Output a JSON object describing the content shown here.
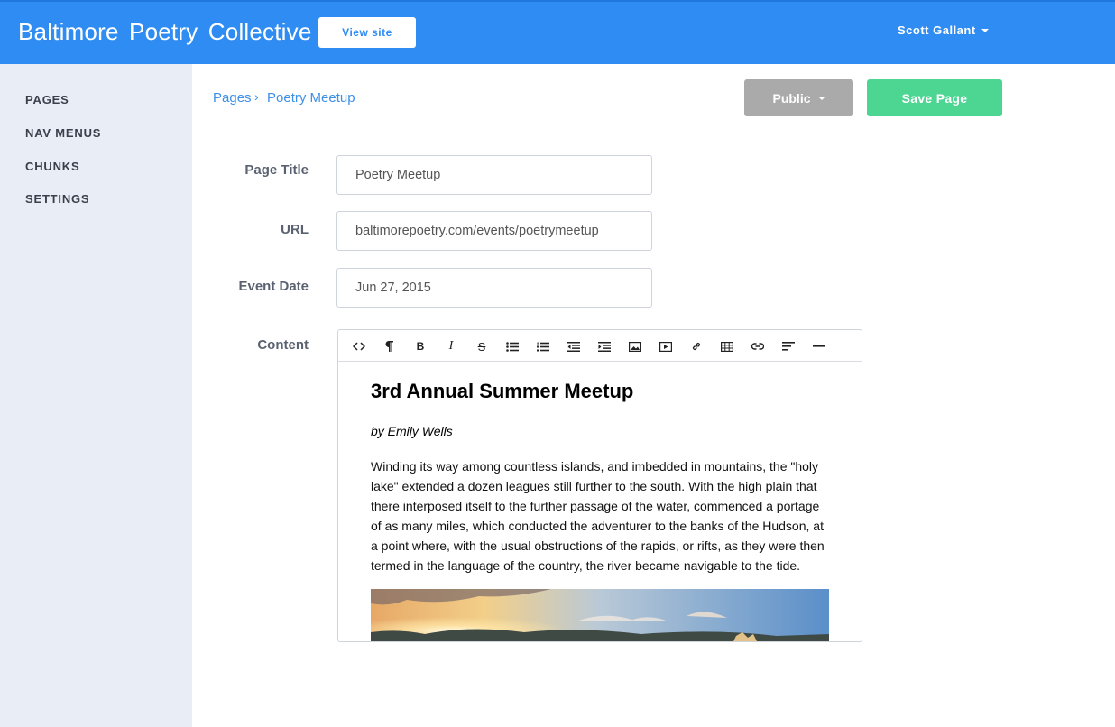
{
  "header": {
    "brand": "Baltimore  Poetry  Collective",
    "view_site_label": "View site",
    "user_name": "Scott Gallant"
  },
  "sidebar": {
    "items": [
      {
        "label": "PAGES"
      },
      {
        "label": "NAV MENUS"
      },
      {
        "label": "CHUNKS"
      },
      {
        "label": "SETTINGS"
      }
    ]
  },
  "breadcrumb": {
    "parent": "Pages",
    "separator": "›",
    "current": "Poetry Meetup"
  },
  "actions": {
    "visibility_label": "Public",
    "save_label": "Save Page"
  },
  "form": {
    "page_title_label": "Page Title",
    "page_title_value": "Poetry Meetup",
    "url_label": "URL",
    "url_value": "baltimorepoetry.com/events/poetrymeetup",
    "event_date_label": "Event Date",
    "event_date_value": "Jun 27, 2015",
    "content_label": "Content"
  },
  "editor": {
    "toolbar": [
      "html-icon",
      "paragraph-icon",
      "bold-icon",
      "italic-icon",
      "strikethrough-icon",
      "unordered-list-icon",
      "ordered-list-icon",
      "outdent-icon",
      "indent-icon",
      "image-icon",
      "video-icon",
      "link-icon",
      "table-icon",
      "link-alt-icon",
      "align-icon",
      "horizontal-rule-icon"
    ],
    "heading": "3rd Annual Summer Meetup",
    "author": "by Emily Wells",
    "paragraph": "Winding its way among countless islands, and imbedded in mountains, the \"holy lake\" extended a dozen leagues still further to the south. With the high plain that there interposed itself to the further passage of the water, commenced a portage of as many miles, which conducted the adventurer to the banks of the Hudson, at a point where, with the usual obstructions of the rapids, or rifts, as they were then termed in the language of the country, the river became navigable to the tide."
  },
  "colors": {
    "primary": "#2e8cf3",
    "save": "#4dd592",
    "public": "#aaaaaa",
    "sidebar": "#e9eef6"
  }
}
